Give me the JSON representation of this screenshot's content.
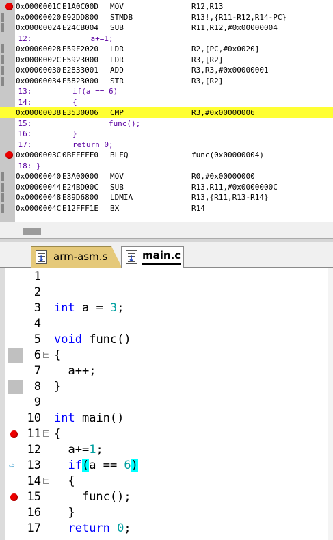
{
  "disassembly": {
    "rows": [
      {
        "type": "asm",
        "marker": "breakpoint",
        "addr": "0x0000001C",
        "hex": "E1A0C00D",
        "mnemonic": "MOV",
        "operands": "R12,R13"
      },
      {
        "type": "asm",
        "marker": "bar",
        "addr": "0x00000020",
        "hex": "E92DD800",
        "mnemonic": "STMDB",
        "operands": "R13!,{R11-R12,R14-PC}"
      },
      {
        "type": "asm",
        "marker": "bar",
        "addr": "0x00000024",
        "hex": "E24CB004",
        "mnemonic": "SUB",
        "operands": "R11,R12,#0x00000004"
      },
      {
        "type": "src",
        "marker": "",
        "text": "    12:             a+=1;"
      },
      {
        "type": "asm",
        "marker": "bar",
        "addr": "0x00000028",
        "hex": "E59F2020",
        "mnemonic": "LDR",
        "operands": "R2,[PC,#0x0020]"
      },
      {
        "type": "asm",
        "marker": "bar",
        "addr": "0x0000002C",
        "hex": "E5923000",
        "mnemonic": "LDR",
        "operands": "R3,[R2]"
      },
      {
        "type": "asm",
        "marker": "bar",
        "addr": "0x00000030",
        "hex": "E2833001",
        "mnemonic": "ADD",
        "operands": "R3,R3,#0x00000001"
      },
      {
        "type": "asm",
        "marker": "bar",
        "addr": "0x00000034",
        "hex": "E5823000",
        "mnemonic": "STR",
        "operands": "R3,[R2]"
      },
      {
        "type": "src",
        "marker": "",
        "text": "    13:         if(a == 6)"
      },
      {
        "type": "src",
        "marker": "",
        "text": "    14:         {"
      },
      {
        "type": "asm",
        "marker": "",
        "highlight": true,
        "addr": "0x00000038",
        "hex": "E3530006",
        "mnemonic": "CMP",
        "operands": "R3,#0x00000006"
      },
      {
        "type": "src",
        "marker": "",
        "text": "    15:                 func();"
      },
      {
        "type": "src",
        "marker": "",
        "text": "    16:         }"
      },
      {
        "type": "src",
        "marker": "",
        "text": "    17:         return 0;"
      },
      {
        "type": "asm",
        "marker": "breakpoint",
        "addr": "0x0000003C",
        "hex": "0BFFFFF0",
        "mnemonic": "BLEQ",
        "operands": "func(0x00000004)"
      },
      {
        "type": "src",
        "marker": "",
        "text": "    18: }"
      },
      {
        "type": "asm",
        "marker": "bar",
        "addr": "0x00000040",
        "hex": "E3A00000",
        "mnemonic": "MOV",
        "operands": "R0,#0x00000000"
      },
      {
        "type": "asm",
        "marker": "bar",
        "addr": "0x00000044",
        "hex": "E24BD00C",
        "mnemonic": "SUB",
        "operands": "R13,R11,#0x0000000C"
      },
      {
        "type": "asm",
        "marker": "bar",
        "addr": "0x00000048",
        "hex": "E89D6800",
        "mnemonic": "LDMIA",
        "operands": "R13,{R11,R13-R14}"
      },
      {
        "type": "asm",
        "marker": "bar",
        "addr": "0x0000004C",
        "hex": "E12FFF1E",
        "mnemonic": "BX",
        "operands": "R14"
      }
    ]
  },
  "tabs": [
    {
      "label": "arm-asm.s",
      "icon": "source-file-icon",
      "active": false
    },
    {
      "label": "main.c",
      "icon": "source-file-icon",
      "active": true
    }
  ],
  "editor": {
    "lines": [
      {
        "num": "1",
        "marker": "",
        "fold": "",
        "code": ""
      },
      {
        "num": "2",
        "marker": "",
        "fold": "",
        "code": ""
      },
      {
        "num": "3",
        "marker": "",
        "fold": "",
        "code": "int a = 3;"
      },
      {
        "num": "4",
        "marker": "",
        "fold": "",
        "code": ""
      },
      {
        "num": "5",
        "marker": "",
        "fold": "",
        "code": "void func()"
      },
      {
        "num": "6",
        "marker": "gray",
        "fold": "minus",
        "code": "{"
      },
      {
        "num": "7",
        "marker": "",
        "fold": "",
        "code": "  a++;"
      },
      {
        "num": "8",
        "marker": "gray",
        "fold": "",
        "code": "}"
      },
      {
        "num": "9",
        "marker": "",
        "fold": "",
        "code": ""
      },
      {
        "num": "10",
        "marker": "",
        "fold": "",
        "code": "int main()"
      },
      {
        "num": "11",
        "marker": "breakpoint",
        "fold": "minus",
        "code": "{"
      },
      {
        "num": "12",
        "marker": "",
        "fold": "",
        "code": "  a+=1;"
      },
      {
        "num": "13",
        "marker": "arrow",
        "fold": "",
        "code": "  if(a == 6)"
      },
      {
        "num": "14",
        "marker": "",
        "fold": "minus",
        "code": "  {"
      },
      {
        "num": "15",
        "marker": "breakpoint",
        "fold": "",
        "code": "    func();"
      },
      {
        "num": "16",
        "marker": "",
        "fold": "",
        "code": "  }"
      },
      {
        "num": "17",
        "marker": "",
        "fold": "",
        "code": "  return 0;"
      }
    ]
  },
  "colors": {
    "highlight": "#ffff33",
    "keyword": "#0000ff",
    "number": "#00a0a0",
    "brace_match": "#00ffff",
    "breakpoint": "#ee0000"
  }
}
